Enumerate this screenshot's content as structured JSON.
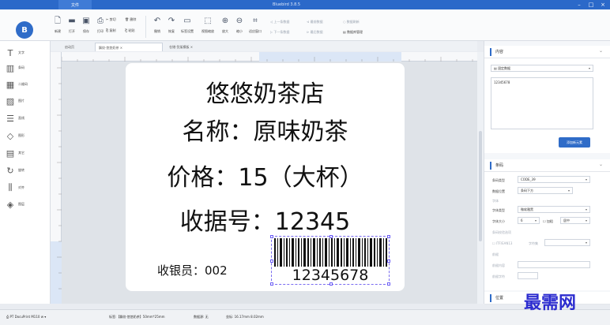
{
  "titlebar": {
    "file_menu": "文件",
    "title": "Bluebird 3.8.5",
    "minimize": "–",
    "maximize": "□",
    "close": "×"
  },
  "logo": {
    "text": "B"
  },
  "ribbon": {
    "buttons": [
      {
        "label": "新建",
        "icon": "new-file-icon",
        "glyph": "🗋"
      },
      {
        "label": "打开",
        "icon": "open-folder-icon",
        "glyph": "▬"
      },
      {
        "label": "保存",
        "icon": "save-icon",
        "glyph": "▣"
      },
      {
        "label": "打印",
        "icon": "print-icon",
        "glyph": "⎙"
      },
      {
        "label": "撤销",
        "icon": "undo-icon",
        "glyph": "↶"
      },
      {
        "label": "恢复",
        "icon": "redo-icon",
        "glyph": "↷"
      },
      {
        "label": "标签设置",
        "icon": "label-settings-icon",
        "glyph": "▭"
      },
      {
        "label": "视图缩放",
        "icon": "view-zoom-icon",
        "glyph": "⬚"
      },
      {
        "label": "放大",
        "icon": "zoom-in-icon",
        "glyph": "⊕"
      },
      {
        "label": "缩小",
        "icon": "zoom-out-icon",
        "glyph": "⊖"
      },
      {
        "label": "适应窗口",
        "icon": "fit-window-icon",
        "glyph": "⌗"
      }
    ],
    "edit_small": {
      "cut": "剪切",
      "copy": "复制",
      "delete": "删除",
      "paste": "粘贴"
    },
    "nav_small": {
      "prev": "上一条数据",
      "next": "下一条数据",
      "first": "最前数据",
      "last": "最后数据",
      "refresh": "数据刷新",
      "manage": "数据库管理"
    }
  },
  "tools": [
    {
      "label": "文字",
      "icon": "text-tool-icon",
      "glyph": "T"
    },
    {
      "label": "条码",
      "icon": "barcode-tool-icon",
      "glyph": "▥"
    },
    {
      "label": "二维码",
      "icon": "qrcode-tool-icon",
      "glyph": "▦"
    },
    {
      "label": "图片",
      "icon": "image-tool-icon",
      "glyph": "▨"
    },
    {
      "label": "直线",
      "icon": "line-tool-icon",
      "glyph": "☰"
    },
    {
      "label": "图形",
      "icon": "shape-tool-icon",
      "glyph": "◇"
    },
    {
      "label": "其它",
      "icon": "other-tool-icon",
      "glyph": "▤"
    },
    {
      "label": "旋转",
      "icon": "rotate-tool-icon",
      "glyph": "↻"
    },
    {
      "label": "对齐",
      "icon": "align-tool-icon",
      "glyph": "⫼"
    },
    {
      "label": "图层",
      "icon": "layer-tool-icon",
      "glyph": "◈"
    }
  ],
  "tabs": [
    {
      "label": "启动页"
    },
    {
      "label": "飘纹-悠悠奶茶 ×"
    },
    {
      "label": "仓储-货架模板 ×"
    }
  ],
  "label": {
    "lines": [
      "悠悠奶茶店",
      "名称：原味奶茶",
      "价格：15（大杯）",
      "收据号：12345"
    ],
    "cashier": "收银员：002",
    "barcode_number": "12345678"
  },
  "panel": {
    "content": {
      "title": "内容",
      "source": "固定数据",
      "value": "12345678",
      "add_button": "添加新元素"
    },
    "barcode": {
      "title": "条码",
      "type_label": "条码类型",
      "type_value": "CODE_39",
      "pos_label": "数据位置",
      "pos_value": "条码下方",
      "font_section": "字体",
      "font_type_label": "字体类型",
      "font_type_value": "微软雅黑",
      "font_size_label": "字体大小",
      "font_size_value": "6",
      "bold": "加粗",
      "center": "居中",
      "check_section": "条码校验选项",
      "check_label": "ITF/EAN13",
      "char_label": "字符集",
      "prefix_section": "前缀",
      "prefix_content": "前缀内容",
      "prefix_chars": "前缀字符"
    },
    "position": {
      "title": "位置"
    }
  },
  "statusbar": {
    "printer": "PT DocuPrint M110 w",
    "template": "标签:【飘纹-悠悠奶茶】50mm*25mm",
    "records": "数据源: 无",
    "coords": "坐标: 16.17mm 8.02mm"
  },
  "watermark": "最需网",
  "colors": {
    "accent": "#2f6cc8",
    "titlebar": "#2b69c9",
    "selection": "#6b5cf5"
  }
}
